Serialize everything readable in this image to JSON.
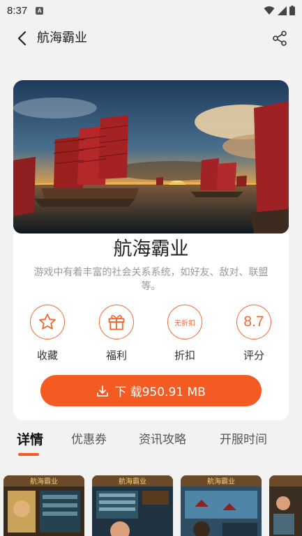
{
  "status_bar": {
    "time": "8:37",
    "app_icon_letter": "A"
  },
  "app_bar": {
    "title": "航海霸业"
  },
  "game": {
    "name": "航海霸业",
    "description": "游戏中有着丰富的社会关系系统，如好友、敌对、联盟等。"
  },
  "actions": [
    {
      "label": "收藏",
      "icon": "star-icon"
    },
    {
      "label": "福利",
      "icon": "gift-icon"
    },
    {
      "label": "折扣",
      "icon": "discount-badge",
      "value": "无折扣"
    },
    {
      "label": "评分",
      "icon": "rating-badge",
      "value": "8.7"
    }
  ],
  "download": {
    "label": "下 载950.91 MB"
  },
  "tabs": [
    {
      "label": "详情",
      "active": true
    },
    {
      "label": "优惠券",
      "active": false
    },
    {
      "label": "资讯攻略",
      "active": false
    },
    {
      "label": "开服时间",
      "active": false
    }
  ],
  "screenshots": [
    {
      "title": "航海霸业"
    },
    {
      "title": "航海霸业"
    },
    {
      "title": "航海霸业"
    }
  ],
  "colors": {
    "accent": "#f35b22",
    "accent_outline": "#f06a38",
    "background": "#f2f2f2"
  }
}
